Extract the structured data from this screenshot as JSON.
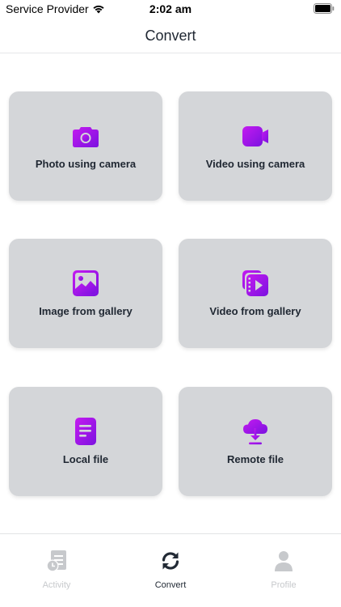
{
  "status_bar": {
    "carrier": "Service Provider",
    "time": "2:02 am"
  },
  "header": {
    "title": "Convert"
  },
  "options": [
    {
      "label": "Photo using camera",
      "icon": "camera-icon"
    },
    {
      "label": "Video using camera",
      "icon": "video-camera-icon"
    },
    {
      "label": "Image from gallery",
      "icon": "image-gallery-icon"
    },
    {
      "label": "Video from gallery",
      "icon": "video-gallery-icon"
    },
    {
      "label": "Local file",
      "icon": "document-icon"
    },
    {
      "label": "Remote file",
      "icon": "cloud-download-icon"
    }
  ],
  "tabs": [
    {
      "label": "Activity",
      "icon": "activity-icon",
      "active": false
    },
    {
      "label": "Convert",
      "icon": "refresh-icon",
      "active": true
    },
    {
      "label": "Profile",
      "icon": "user-icon",
      "active": false
    }
  ],
  "colors": {
    "accent_gradient_start": "#c51bf0",
    "accent_gradient_end": "#7b12e0",
    "card_background": "#d4d6d9",
    "tab_inactive": "#c7c9cc",
    "tab_active": "#222a35"
  }
}
